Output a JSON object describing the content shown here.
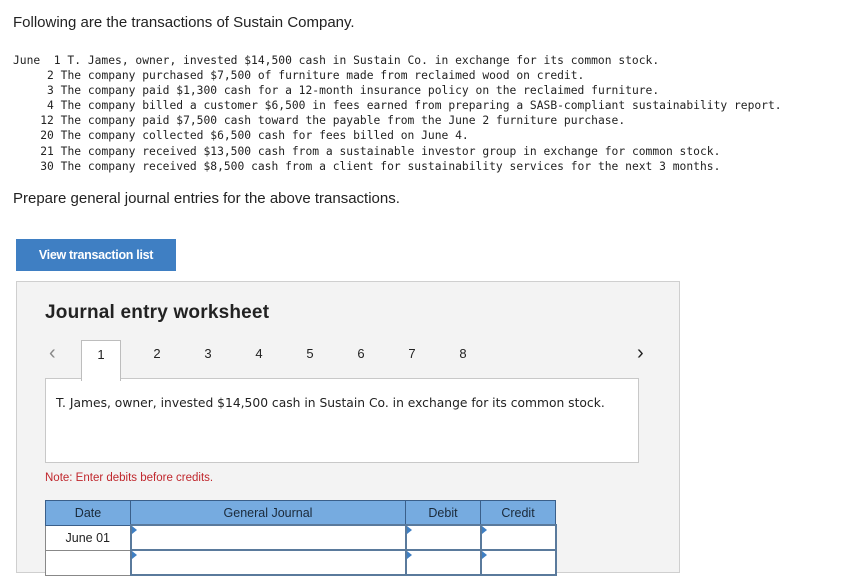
{
  "intro": "Following are the transactions of Sustain Company.",
  "transactions": [
    {
      "date": "June  1",
      "text": "T. James, owner, invested $14,500 cash in Sustain Co. in exchange for its common stock."
    },
    {
      "date": "2",
      "text": "The company purchased $7,500 of furniture made from reclaimed wood on credit."
    },
    {
      "date": "3",
      "text": "The company paid $1,300 cash for a 12-month insurance policy on the reclaimed furniture."
    },
    {
      "date": "4",
      "text": "The company billed a customer $6,500 in fees earned from preparing a SASB-compliant sustainability report."
    },
    {
      "date": "12",
      "text": "The company paid $7,500 cash toward the payable from the June 2 furniture purchase."
    },
    {
      "date": "20",
      "text": "The company collected $6,500 cash for fees billed on June 4."
    },
    {
      "date": "21",
      "text": "The company received $13,500 cash from a sustainable investor group in exchange for common stock."
    },
    {
      "date": "30",
      "text": "The company received $8,500 cash from a client for sustainability services for the next 3 months."
    }
  ],
  "prepare": "Prepare general journal entries for the above transactions.",
  "view_button": "View transaction list",
  "worksheet": {
    "title": "Journal entry worksheet",
    "tabs": [
      "1",
      "2",
      "3",
      "4",
      "5",
      "6",
      "7",
      "8"
    ],
    "active_tab": "1",
    "prev_icon": "chevron-left",
    "next_icon": "chevron-right",
    "description": "T. James, owner, invested $14,500 cash in Sustain Co. in exchange for its common stock.",
    "note": "Note: Enter debits before credits.",
    "columns": [
      "Date",
      "General Journal",
      "Debit",
      "Credit"
    ],
    "rows": [
      {
        "date": "June 01",
        "account": "",
        "debit": "",
        "credit": ""
      },
      {
        "date": "",
        "account": "",
        "debit": "",
        "credit": ""
      }
    ]
  }
}
